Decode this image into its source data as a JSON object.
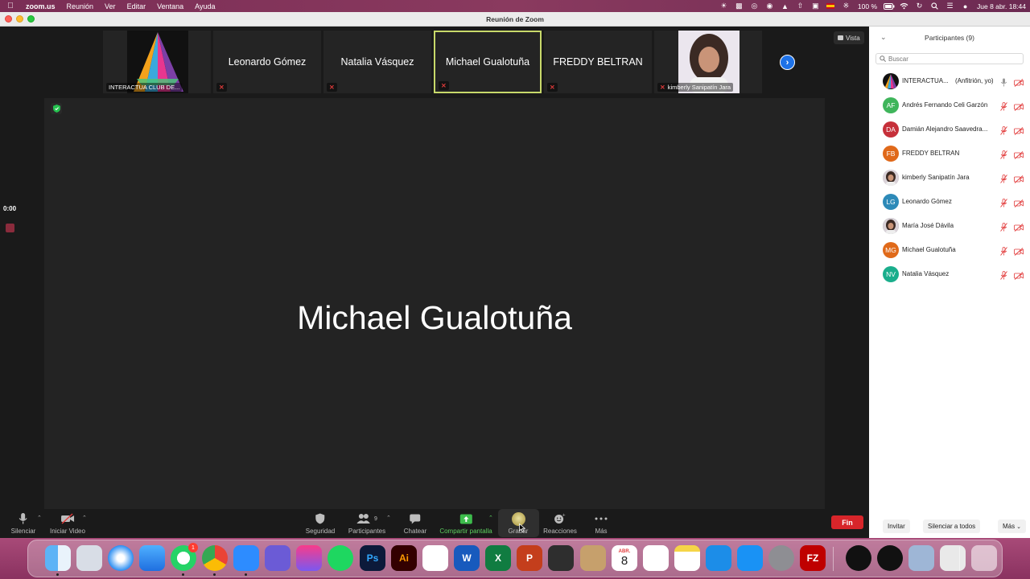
{
  "menubar": {
    "app_name": "zoom.us",
    "menus": [
      "Reunión",
      "Ver",
      "Editar",
      "Ventana",
      "Ayuda"
    ],
    "battery": "100 %",
    "datetime": "Jue 8 abr.  18:44"
  },
  "window": {
    "title": "Reunión de Zoom"
  },
  "meeting": {
    "view_button": "Vista",
    "thumbnails": [
      {
        "name": "INTERACTUA CLUB DE...",
        "kind": "logo",
        "muted": false
      },
      {
        "name": "Leonardo Gómez",
        "kind": "name",
        "muted": true
      },
      {
        "name": "Natalia Vásquez",
        "kind": "name",
        "muted": true
      },
      {
        "name": "Michael Gualotuña",
        "kind": "name",
        "muted": true,
        "active": true
      },
      {
        "name": "FREDDY BELTRAN",
        "kind": "name",
        "muted": true
      },
      {
        "name": "kimberly Sanipatín Jara",
        "kind": "photo",
        "muted": true
      }
    ],
    "active_speaker": "Michael Gualotuña",
    "recording_timer": "0:00"
  },
  "toolbar": {
    "mute": "Silenciar",
    "video": "Iniciar Video",
    "security": "Seguridad",
    "participants": "Participantes",
    "participants_count": "9",
    "chat": "Chatear",
    "share": "Compartir pantalla",
    "record": "Grabar",
    "reactions": "Reacciones",
    "more": "Más",
    "end": "Fin"
  },
  "panel": {
    "title": "Participantes (9)",
    "search_placeholder": "Buscar",
    "participants": [
      {
        "name": "INTERACTUA...",
        "role": "(Anfitrión, yo)",
        "initials": "",
        "color": "#111111",
        "avatar": "logo",
        "mic": "on"
      },
      {
        "name": "Andrés Fernando Celi Garzón",
        "role": "",
        "initials": "AF",
        "color": "#3fb55b",
        "avatar": "initials",
        "mic": "muted"
      },
      {
        "name": "Damián Alejandro Saavedra...",
        "role": "",
        "initials": "DA",
        "color": "#c6303a",
        "avatar": "initials",
        "mic": "muted"
      },
      {
        "name": "FREDDY BELTRAN",
        "role": "",
        "initials": "FB",
        "color": "#e0691a",
        "avatar": "initials",
        "mic": "muted"
      },
      {
        "name": "kimberly Sanipatín Jara",
        "role": "",
        "initials": "",
        "color": "#bba9b8",
        "avatar": "photo",
        "mic": "muted"
      },
      {
        "name": "Leonardo Gómez",
        "role": "",
        "initials": "LG",
        "color": "#2d8ab8",
        "avatar": "initials",
        "mic": "muted"
      },
      {
        "name": "María José Dávila",
        "role": "",
        "initials": "",
        "color": "#6a6f7d",
        "avatar": "photo",
        "mic": "muted"
      },
      {
        "name": "Michael Gualotuña",
        "role": "",
        "initials": "MG",
        "color": "#e06a1a",
        "avatar": "initials",
        "mic": "muted"
      },
      {
        "name": "Natalia Vásquez",
        "role": "",
        "initials": "NV",
        "color": "#1aae8c",
        "avatar": "initials",
        "mic": "muted"
      }
    ],
    "invite": "Invitar",
    "mute_all": "Silenciar a todos",
    "more": "Más"
  },
  "dock": {
    "apps": [
      "finder",
      "launchpad",
      "safari",
      "mail",
      "whatsapp",
      "chrome",
      "zoom",
      "app-sparkle",
      "clickup",
      "spotify",
      "photoshop",
      "illustrator",
      "acrobat",
      "word",
      "excel",
      "powerpoint",
      "calculator",
      "contacts",
      "calendar",
      "reminders",
      "notes",
      "keynote",
      "app-store",
      "system-preferences",
      "filezilla",
      "logitech-g",
      "logitech-g-hub",
      "preview",
      "dropzone",
      "trash"
    ],
    "whatsapp_badge": "1",
    "calendar_month": "ABR.",
    "calendar_day": "8",
    "icons": {
      "photoshop": "Ps",
      "illustrator": "Ai",
      "word": "W",
      "excel": "X",
      "powerpoint": "P",
      "filezilla": "FZ"
    }
  },
  "colors": {
    "accent_green": "#5dd05f",
    "end_red": "#d7252a",
    "active_border": "#c8d96a",
    "link_blue": "#1e72e8"
  }
}
